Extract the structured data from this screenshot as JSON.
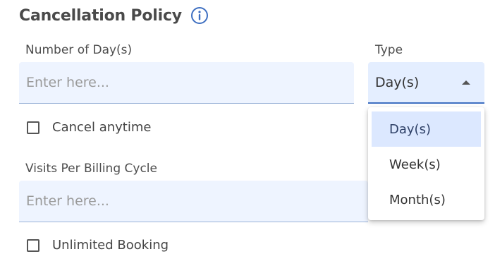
{
  "heading": {
    "title": "Cancellation Policy",
    "info_icon": "info-icon"
  },
  "days_field": {
    "label": "Number of Day(s)",
    "value": "",
    "placeholder": "Enter here..."
  },
  "type_field": {
    "label": "Type",
    "selected": "Day(s)",
    "icon": "caret-up-icon",
    "options": [
      "Day(s)",
      "Week(s)",
      "Month(s)"
    ]
  },
  "cancel_anytime": {
    "label": "Cancel anytime",
    "checked": false
  },
  "visits_field": {
    "label": "Visits Per Billing Cycle",
    "value": "",
    "placeholder": "Enter here..."
  },
  "unlimited_booking": {
    "label": "Unlimited Booking",
    "checked": false
  },
  "colors": {
    "accent": "#3e6fc1",
    "input_bg": "#eef4ff",
    "selected_option_bg": "#dce8ff"
  }
}
